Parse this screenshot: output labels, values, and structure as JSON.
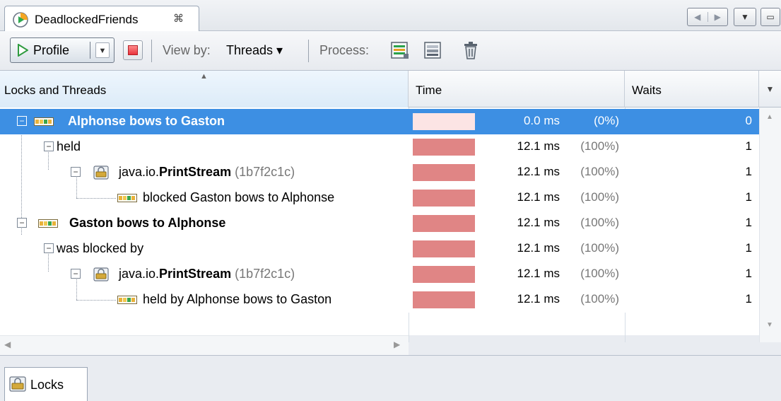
{
  "window": {
    "tab_title": "DeadlockedFriends",
    "tab_close_glyph": "⌘",
    "nav_left_glyph": "◀",
    "nav_right_glyph": "▶",
    "dropdown_glyph": "▼",
    "restore_glyph": "▭"
  },
  "toolbar": {
    "profile_label": "Profile",
    "profile_dropdown_glyph": "▼",
    "view_by_label": "View by:",
    "view_by_value": "Threads ▾",
    "process_label": "Process:",
    "icons": [
      "thread-dump-icon",
      "heap-dump-icon",
      "trash-icon"
    ]
  },
  "table": {
    "columns": {
      "locks": "Locks and Threads",
      "time": "Time",
      "waits": "Waits",
      "sort_glyph": "▲",
      "menu_glyph": "▼"
    },
    "rows": [
      {
        "pre": "",
        "strong": "Alphonse bows to Gaston",
        "post": "",
        "time": "0.0 ms",
        "pct": "(0%)",
        "waits": "0",
        "bar_fraction": 0.0,
        "icon": "thread-icon",
        "expander": "−",
        "selected": true
      },
      {
        "pre": "held",
        "strong": "",
        "post": "",
        "time": "12.1 ms",
        "pct": "(100%)",
        "waits": "1",
        "bar_fraction": 1.0,
        "icon": "",
        "expander": "−",
        "selected": false
      },
      {
        "pre": "java.io.",
        "strong": "PrintStream",
        "post": "(1b7f2c1c)",
        "time": "12.1 ms",
        "pct": "(100%)",
        "waits": "1",
        "bar_fraction": 1.0,
        "icon": "lock-icon",
        "expander": "−",
        "selected": false
      },
      {
        "pre": "blocked Gaston bows to Alphonse",
        "strong": "",
        "post": "",
        "time": "12.1 ms",
        "pct": "(100%)",
        "waits": "1",
        "bar_fraction": 1.0,
        "icon": "thread-icon",
        "expander": "",
        "selected": false
      },
      {
        "pre": "",
        "strong": "Gaston bows to Alphonse",
        "post": "",
        "time": "12.1 ms",
        "pct": "(100%)",
        "waits": "1",
        "bar_fraction": 1.0,
        "icon": "thread-icon",
        "expander": "−",
        "selected": false
      },
      {
        "pre": "was blocked by",
        "strong": "",
        "post": "",
        "time": "12.1 ms",
        "pct": "(100%)",
        "waits": "1",
        "bar_fraction": 1.0,
        "icon": "",
        "expander": "−",
        "selected": false
      },
      {
        "pre": "java.io.",
        "strong": "PrintStream",
        "post": "(1b7f2c1c)",
        "time": "12.1 ms",
        "pct": "(100%)",
        "waits": "1",
        "bar_fraction": 1.0,
        "icon": "lock-icon",
        "expander": "−",
        "selected": false
      },
      {
        "pre": "held by Alphonse bows to Gaston",
        "strong": "",
        "post": "",
        "time": "12.1 ms",
        "pct": "(100%)",
        "waits": "1",
        "bar_fraction": 1.0,
        "icon": "thread-icon",
        "expander": "",
        "selected": false
      }
    ]
  },
  "scroll": {
    "up_glyph": "▲",
    "down_glyph": "▼",
    "left_glyph": "◀",
    "right_glyph": "▶"
  },
  "bottom": {
    "locks_tab_label": "Locks"
  },
  "colors": {
    "selection": "#3d8fe3",
    "time_bar": "#e08585",
    "time_bar_selected": "#fce4e4"
  }
}
